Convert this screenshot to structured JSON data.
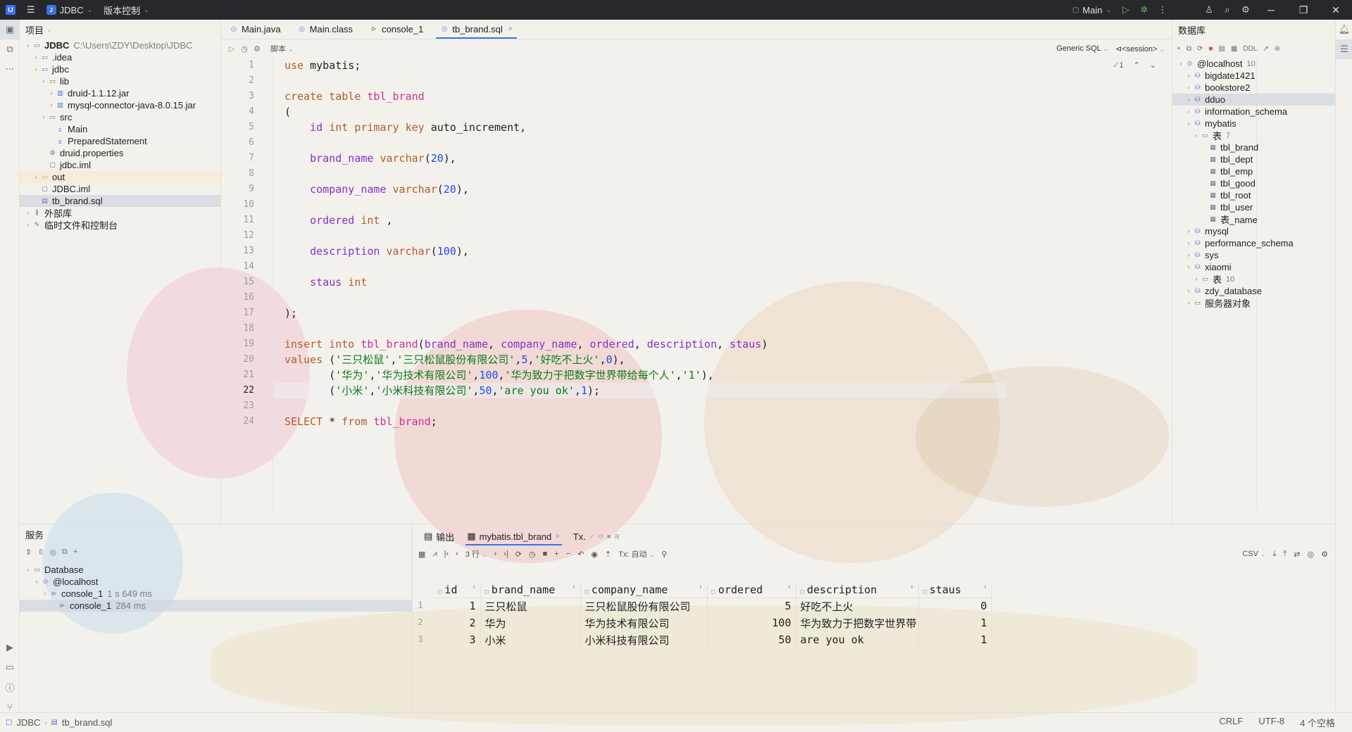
{
  "titlebar": {
    "project_badge": "J",
    "project_name": "JDBC",
    "vcs": "版本控制",
    "run_config": "Main",
    "colors": {
      "bg": "#27282c",
      "accent": "#3873e8",
      "run": "#5fb865"
    }
  },
  "project_panel": {
    "title": "项目",
    "tree": [
      {
        "label": "JDBC",
        "path": "C:\\Users\\ZDY\\Desktop\\JDBC",
        "depth": 0,
        "icon": "folder-icon"
      },
      {
        "label": ".idea",
        "depth": 1,
        "icon": "folder-icon"
      },
      {
        "label": "jdbc",
        "depth": 1,
        "icon": "module-icon"
      },
      {
        "label": "lib",
        "depth": 2,
        "icon": "folder-icon"
      },
      {
        "label": "druid-1.1.12.jar",
        "depth": 3,
        "icon": "jar-icon"
      },
      {
        "label": "mysql-connector-java-8.0.15.jar",
        "depth": 3,
        "icon": "jar-icon"
      },
      {
        "label": "src",
        "depth": 2,
        "icon": "source-folder-icon"
      },
      {
        "label": "Main",
        "depth": 3,
        "icon": "class-icon"
      },
      {
        "label": "PreparedStatement",
        "depth": 3,
        "icon": "class-icon"
      },
      {
        "label": "druid.properties",
        "depth": 2,
        "icon": "properties-icon"
      },
      {
        "label": "jdbc.iml",
        "depth": 2,
        "icon": "iml-icon"
      },
      {
        "label": "out",
        "depth": 1,
        "icon": "folder-orange-icon"
      },
      {
        "label": "JDBC.iml",
        "depth": 1,
        "icon": "iml-icon"
      },
      {
        "label": "tb_brand.sql",
        "depth": 1,
        "icon": "sql-icon"
      },
      {
        "label": "外部库",
        "depth": 0,
        "icon": "library-icon"
      },
      {
        "label": "临时文件和控制台",
        "depth": 0,
        "icon": "scratch-icon"
      }
    ]
  },
  "tabs": [
    {
      "label": "Main.java",
      "icon": "java-icon"
    },
    {
      "label": "Main.class",
      "icon": "class-file-icon"
    },
    {
      "label": "console_1",
      "icon": "console-icon"
    },
    {
      "label": "tb_brand.sql",
      "icon": "sql-icon",
      "active": true
    }
  ],
  "editor_toolbar": {
    "script_label": "脚本",
    "dialect": "Generic SQL",
    "session": "<session>",
    "inspections": "1"
  },
  "editor": {
    "current_line": 22,
    "lines": [
      "use mybatis;",
      "",
      "create table tbl_brand",
      "(",
      "    id int primary key auto_increment,",
      "",
      "    brand_name varchar(20),",
      "",
      "    company_name varchar(20),",
      "",
      "    ordered int ,",
      "",
      "    description varchar(100),",
      "",
      "    staus int",
      "",
      ");",
      "",
      "insert into tbl_brand(brand_name, company_name, ordered, description, staus)",
      "values ('三只松鼠','三只松鼠股份有限公司',5,'好吃不上火',0),",
      "       ('华为','华为技术有限公司',100,'华为致力于把数字世界带给每个人','1'),",
      "       ('小米','小米科技有限公司',50,'are you ok',1);",
      "",
      "SELECT * from tbl_brand;"
    ]
  },
  "db_panel": {
    "title": "数据库",
    "ddl_label": "DDL",
    "tree": [
      {
        "label": "@localhost",
        "count": "10",
        "depth": 0,
        "icon": "host-icon"
      },
      {
        "label": "bigdate1421",
        "depth": 1,
        "icon": "schema-icon"
      },
      {
        "label": "bookstore2",
        "depth": 1,
        "icon": "schema-icon"
      },
      {
        "label": "dduo",
        "depth": 1,
        "icon": "schema-icon",
        "selected": true
      },
      {
        "label": "information_schema",
        "depth": 1,
        "icon": "schema-icon"
      },
      {
        "label": "mybatis",
        "depth": 1,
        "icon": "schema-icon"
      },
      {
        "label": "表",
        "count": "7",
        "depth": 2,
        "icon": "folder-icon"
      },
      {
        "label": "tbl_brand",
        "depth": 3,
        "icon": "table-icon"
      },
      {
        "label": "tbl_dept",
        "depth": 3,
        "icon": "table-icon"
      },
      {
        "label": "tbl_emp",
        "depth": 3,
        "icon": "table-icon"
      },
      {
        "label": "tbl_good",
        "depth": 3,
        "icon": "table-icon"
      },
      {
        "label": "tbl_root",
        "depth": 3,
        "icon": "table-icon"
      },
      {
        "label": "tbl_user",
        "depth": 3,
        "icon": "table-icon"
      },
      {
        "label": "表_name",
        "depth": 3,
        "icon": "table-icon"
      },
      {
        "label": "mysql",
        "depth": 1,
        "icon": "schema-icon"
      },
      {
        "label": "performance_schema",
        "depth": 1,
        "icon": "schema-icon"
      },
      {
        "label": "sys",
        "depth": 1,
        "icon": "schema-icon"
      },
      {
        "label": "xiaomi",
        "depth": 1,
        "icon": "schema-icon"
      },
      {
        "label": "表",
        "count": "10",
        "depth": 2,
        "icon": "folder-icon"
      },
      {
        "label": "zdy_database",
        "depth": 1,
        "icon": "schema-icon"
      },
      {
        "label": "服务器对象",
        "depth": 1,
        "icon": "folder-icon"
      }
    ]
  },
  "services": {
    "title": "服务",
    "tree": [
      {
        "label": "Database",
        "depth": 0,
        "icon": "folder-icon"
      },
      {
        "label": "@localhost",
        "depth": 1,
        "icon": "host-icon"
      },
      {
        "label": "console_1",
        "time": "1 s 649 ms",
        "depth": 2,
        "icon": "console-icon"
      },
      {
        "label": "console_1",
        "time": "284 ms",
        "depth": 3,
        "icon": "console-icon",
        "selected": true
      }
    ]
  },
  "results": {
    "tab_output": "输出",
    "tab_table": "mybatis.tbl_brand",
    "tx_label": "Tx.",
    "rows_label": "3 行",
    "tx_mode": "Tx: 自动",
    "export_format": "CSV",
    "columns": [
      "id",
      "brand_name",
      "company_name",
      "ordered",
      "description",
      "staus"
    ],
    "rows": [
      [
        "1",
        "三只松鼠",
        "三只松鼠股份有限公司",
        "5",
        "好吃不上火",
        "0"
      ],
      [
        "2",
        "华为",
        "华为技术有限公司",
        "100",
        "华为致力于把数字世界带",
        "1"
      ],
      [
        "3",
        "小米",
        "小米科技有限公司",
        "50",
        "are you ok",
        "1"
      ]
    ]
  },
  "statusbar": {
    "breadcrumb_project": "JDBC",
    "breadcrumb_file": "tb_brand.sql",
    "line_sep": "CRLF",
    "encoding": "UTF-8",
    "indent": "4 个空格"
  }
}
